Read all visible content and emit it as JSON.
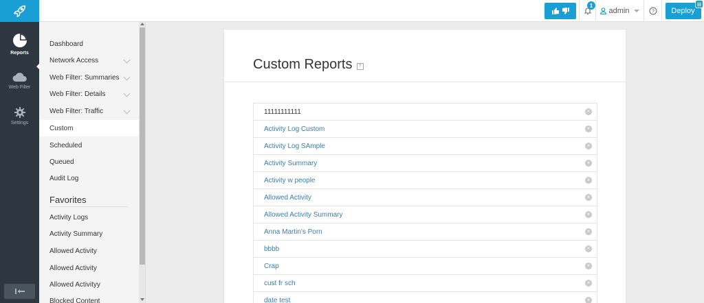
{
  "topbar": {
    "notification_count": "1",
    "user_label": "admin",
    "deploy_label": "Deploy"
  },
  "leftnav": [
    {
      "label": "Reports",
      "icon": "pie-chart-icon",
      "active": true
    },
    {
      "label": "Web Filter",
      "icon": "cloud-icon",
      "active": false
    },
    {
      "label": "Settings",
      "icon": "gear-icon",
      "active": false
    }
  ],
  "sidebar": {
    "items": [
      {
        "label": "Dashboard",
        "expandable": false
      },
      {
        "label": "Network Access",
        "expandable": true
      },
      {
        "label": "Web Filter: Summaries",
        "expandable": true
      },
      {
        "label": "Web Filter: Details",
        "expandable": true
      },
      {
        "label": "Web Filter: Traffic",
        "expandable": true
      },
      {
        "label": "Custom",
        "expandable": false,
        "active": true
      },
      {
        "label": "Scheduled",
        "expandable": false
      },
      {
        "label": "Queued",
        "expandable": false
      },
      {
        "label": "Audit Log",
        "expandable": false
      }
    ],
    "favorites_heading": "Favorites",
    "favorites": [
      "Activity Logs",
      "Activity Summary",
      "Allowed Activity",
      "Allowed Activity",
      "Allowed Activityy",
      "Blocked Content"
    ]
  },
  "main": {
    "title": "Custom Reports",
    "info_glyph": "?",
    "reports": [
      "11111111111",
      "Activity Log Custom",
      "Activity Log SAmple",
      "Activity Summary",
      "Activity w people",
      "Allowed Activity",
      "Allowed Activity Summary",
      "Anna Martin's Porn",
      "bbbb",
      "Crap",
      "cust fr sch",
      "date test"
    ]
  },
  "colors": {
    "accent": "#1a9fd4",
    "nav_bg": "#2e3740",
    "link": "#3a7dab"
  }
}
